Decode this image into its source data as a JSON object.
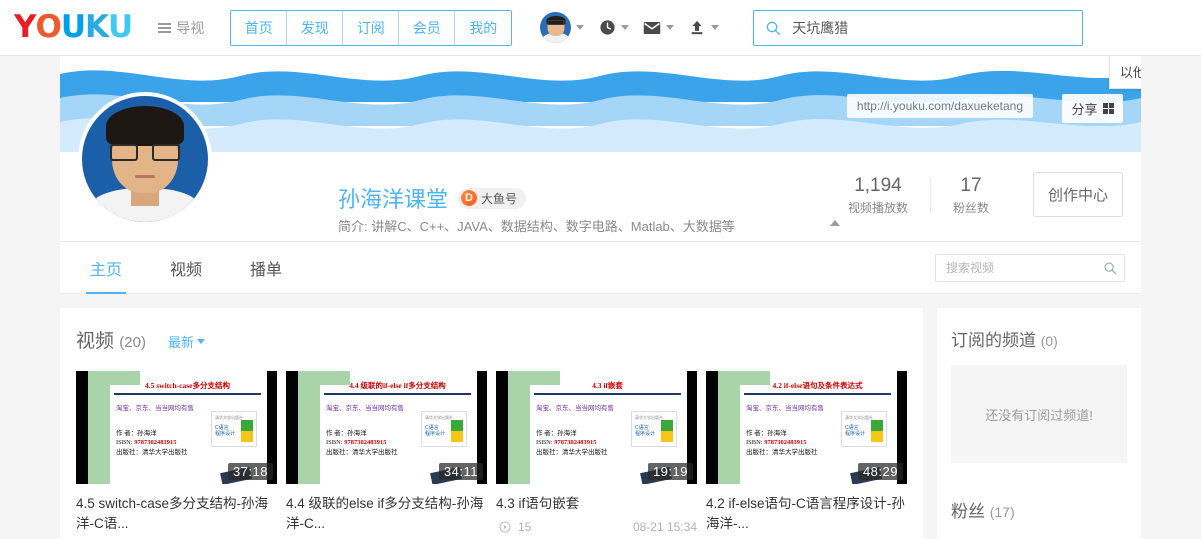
{
  "header": {
    "logo_letters": [
      "Y",
      "O",
      "U",
      "K",
      "U"
    ],
    "guide_label": "导视",
    "nav": [
      {
        "label": "首页"
      },
      {
        "label": "发现"
      },
      {
        "label": "订阅"
      },
      {
        "label": "会员"
      },
      {
        "label": "我的"
      }
    ],
    "icons": [
      {
        "name": "user-avatar"
      },
      {
        "name": "history-clock-icon"
      },
      {
        "name": "mail-icon"
      },
      {
        "name": "upload-icon"
      }
    ],
    "search": {
      "placeholder": "",
      "value": "天坑鹰猎",
      "icon": "search-icon"
    }
  },
  "banner": {
    "url": "http://i.youku.com/daxueketang",
    "share_label": "分享",
    "share_icon": "qrcode-icon",
    "tooltip": "以他人视"
  },
  "profile": {
    "name": "孙海洋课堂",
    "badge": "大鱼号",
    "badge_mark": "D",
    "description": "简介: 讲解C、C++、JAVA、数据结构、数字电路、Matlab、大数据等",
    "stats": [
      {
        "value": "1,194",
        "label": "视频播放数"
      },
      {
        "value": "17",
        "label": "粉丝数"
      }
    ],
    "create_button": "创作中心"
  },
  "tabs": [
    {
      "label": "主页",
      "active": true
    },
    {
      "label": "视频",
      "active": false
    },
    {
      "label": "播单",
      "active": false
    }
  ],
  "video_search": {
    "placeholder": "搜索视频",
    "icon": "search-icon"
  },
  "videos_section": {
    "title": "视频",
    "count": "(20)",
    "sort_label": "最新",
    "items": [
      {
        "title": "4.5 switch-case多分支结构-孙海洋-C语...",
        "duration": "37:18",
        "slide_title": "4.5 switch-case多分支结构",
        "slide_sell": "淘宝、京东、当当网均有售",
        "slide_author": "作  者：孙海洋",
        "slide_isbn_label": "ISBN:",
        "slide_isbn": "9787302483915",
        "slide_press": "出版社：清华大学出版社",
        "views": "",
        "date": ""
      },
      {
        "title": "4.4 级联的else if多分支结构-孙海洋-C...",
        "duration": "34:11",
        "slide_title": "4.4 级联的if-else if多分支结构",
        "slide_sell": "淘宝、京东、当当网均有售",
        "slide_author": "作  者：孙海洋",
        "slide_isbn_label": "ISBN:",
        "slide_isbn": "9787302483915",
        "slide_press": "出版社：清华大学出版社",
        "views": "",
        "date": ""
      },
      {
        "title": "4.3 if语句嵌套",
        "duration": "19:19",
        "slide_title": "4.3 if嵌套",
        "slide_sell": "淘宝、京东、当当网均有售",
        "slide_author": "作  者：孙海洋",
        "slide_isbn_label": "ISBN:",
        "slide_isbn": "9787302483915",
        "slide_press": "出版社：清华大学出版社",
        "views": "15",
        "date": "08-21 15:34"
      },
      {
        "title": "4.2 if-else语句-C语言程序设计-孙海洋-...",
        "duration": "48:29",
        "slide_title": "4.2 if-else语句及条件表达式",
        "slide_sell": "淘宝、京东、当当网均有售",
        "slide_author": "作  者：孙海洋",
        "slide_isbn_label": "ISBN:",
        "slide_isbn": "9787302483915",
        "slide_press": "出版社：清华大学出版社",
        "views": "",
        "date": ""
      }
    ]
  },
  "sidebar": {
    "subscriptions_title": "订阅的频道",
    "subscriptions_count": "(0)",
    "subscriptions_empty": "还没有订阅过频道!",
    "fans_title": "粉丝",
    "fans_count": "(17)"
  },
  "colors": {
    "accent": "#4cb5f3",
    "wave_dark": "#3aa3ea",
    "wave_mid": "#a5d6f7",
    "wave_light": "#d3ebfc"
  }
}
